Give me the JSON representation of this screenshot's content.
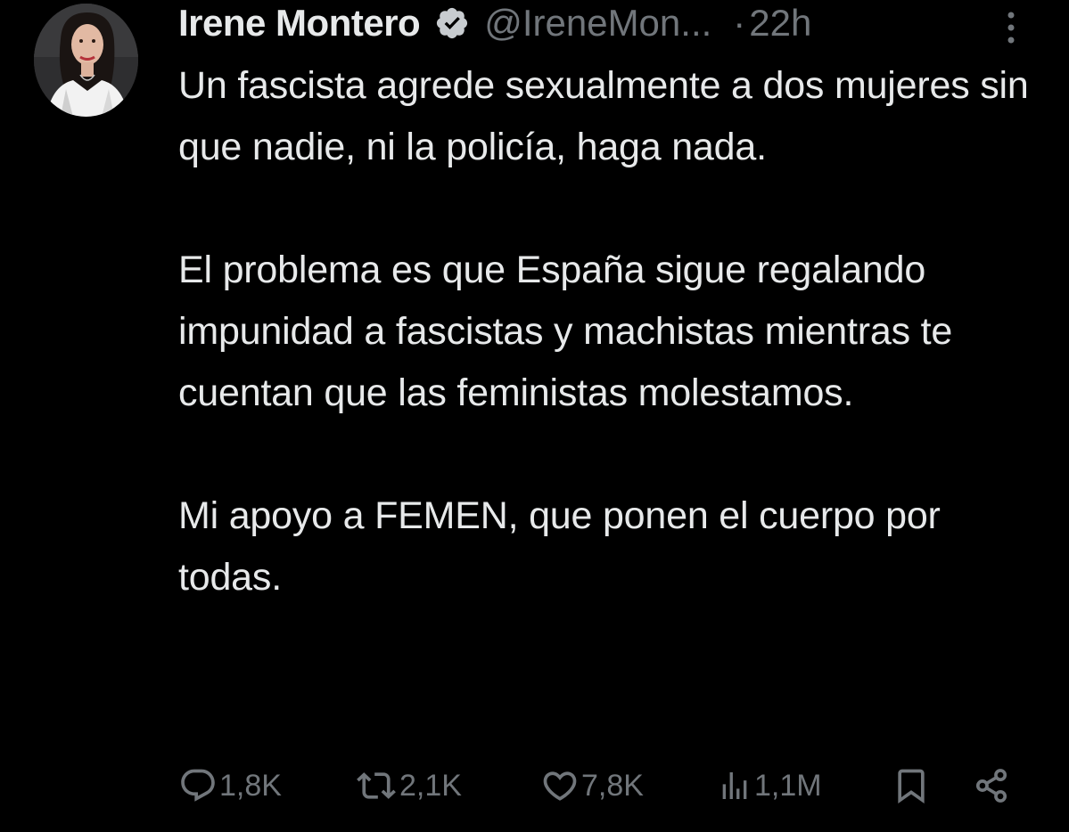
{
  "tweet": {
    "author": {
      "display_name": "Irene Montero",
      "handle": "@IreneMon...",
      "verified": true
    },
    "separator": "·",
    "time_ago": "22h",
    "text_paragraphs": [
      "Un fascista agrede sexualmente a dos mujeres sin que nadie, ni la policía, haga nada.",
      "El problema es que España sigue regalando impunidad a fascistas y machistas mientras te cuentan que las feministas molestamos.",
      "Mi apoyo a FEMEN, que ponen el cuerpo por todas."
    ]
  },
  "actions": {
    "replies": {
      "icon": "reply-icon",
      "count": "1,8K"
    },
    "retweets": {
      "icon": "retweet-icon",
      "count": "2,1K"
    },
    "likes": {
      "icon": "heart-icon",
      "count": "7,8K"
    },
    "views": {
      "icon": "views-icon",
      "count": "1,1M"
    },
    "bookmark": {
      "icon": "bookmark-icon"
    },
    "share": {
      "icon": "share-icon"
    }
  },
  "colors": {
    "background": "#000000",
    "text_primary": "#e7e9ea",
    "text_secondary": "#71767b",
    "verified_badge": "#c8ccd0"
  }
}
